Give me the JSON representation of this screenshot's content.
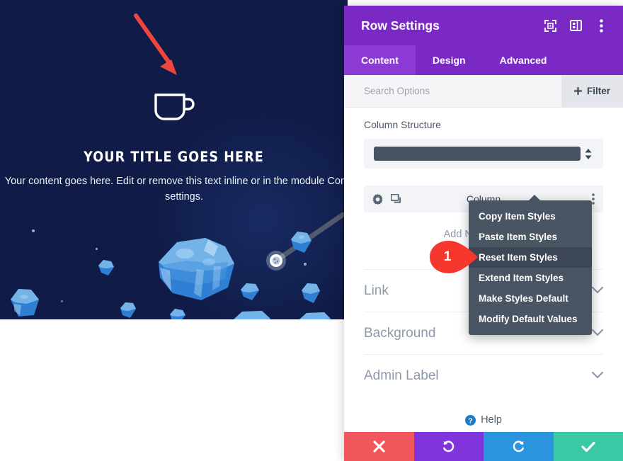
{
  "preview": {
    "icon": "coffee-cup-icon",
    "title": "YOUR TITLE GOES HERE",
    "body": "Your content goes here. Edit or remove this text inline or in the module Content settings.",
    "background_color": "#101c47",
    "arrow_color": "#f0453e"
  },
  "panel": {
    "title": "Row Settings",
    "header_color": "#7a29c4",
    "header_icons": [
      {
        "name": "focus-view-icon"
      },
      {
        "name": "layout-panel-icon"
      },
      {
        "name": "kebab-menu-icon"
      }
    ],
    "tabs": [
      {
        "label": "Content",
        "active": true
      },
      {
        "label": "Design",
        "active": false
      },
      {
        "label": "Advanced",
        "active": false
      }
    ],
    "search": {
      "placeholder": "Search Options",
      "value": ""
    },
    "filter_button": "Filter",
    "column_structure": {
      "label": "Column Structure",
      "selected": ""
    },
    "column_row": {
      "name": "Column",
      "settings_icon": "gear-icon",
      "duplicate_icon": "duplicate-icon",
      "more_icon": "kebab-menu-icon"
    },
    "add_button": "Add New Column",
    "toggles": [
      {
        "label": "Link",
        "expanded": false
      },
      {
        "label": "Background",
        "expanded": false
      },
      {
        "label": "Admin Label",
        "expanded": false
      }
    ],
    "help": {
      "label": "Help",
      "icon": "help-question-icon"
    },
    "bottom_actions": [
      {
        "name": "cancel-button",
        "icon": "x-icon",
        "color": "#f0565b"
      },
      {
        "name": "undo-button",
        "icon": "undo-arrow-icon",
        "color": "#8034db"
      },
      {
        "name": "redo-button",
        "icon": "redo-arrow-icon",
        "color": "#2b94de"
      },
      {
        "name": "save-button",
        "icon": "check-icon",
        "color": "#39c9a5"
      }
    ]
  },
  "context_menu": {
    "items": [
      {
        "label": "Copy Item Styles",
        "active": false
      },
      {
        "label": "Paste Item Styles",
        "active": false
      },
      {
        "label": "Reset Item Styles",
        "active": true
      },
      {
        "label": "Extend Item Styles",
        "active": false
      },
      {
        "label": "Make Styles Default",
        "active": false
      },
      {
        "label": "Modify Default Values",
        "active": false
      }
    ],
    "background_color": "#4a5563"
  },
  "callout": {
    "number": "1",
    "color": "#f5372e"
  }
}
